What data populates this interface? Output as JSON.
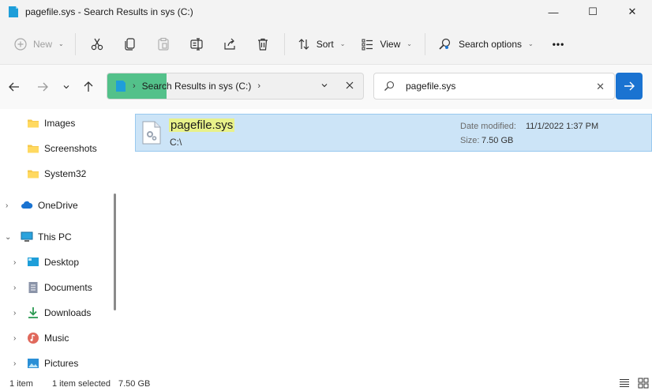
{
  "window": {
    "title": "pagefile.sys - Search Results in sys (C:)",
    "minimize_glyph": "—",
    "maximize_glyph": "☐",
    "close_glyph": "✕"
  },
  "toolbar": {
    "new_label": "New",
    "sort_label": "Sort",
    "view_label": "View",
    "search_options_label": "Search options",
    "more_label": "•••"
  },
  "address": {
    "location": "Search Results in sys (C:)",
    "progress_percent": 23
  },
  "search": {
    "value": "pagefile.sys"
  },
  "sidebar": {
    "items": [
      {
        "label": "Images",
        "icon": "folder-icon"
      },
      {
        "label": "Screenshots",
        "icon": "folder-icon"
      },
      {
        "label": "System32",
        "icon": "folder-icon"
      },
      {
        "label": "OneDrive",
        "icon": "cloud-icon"
      },
      {
        "label": "This PC",
        "icon": "computer-icon"
      },
      {
        "label": "Desktop",
        "icon": "desktop-icon"
      },
      {
        "label": "Documents",
        "icon": "documents-icon"
      },
      {
        "label": "Downloads",
        "icon": "downloads-icon"
      },
      {
        "label": "Music",
        "icon": "music-icon"
      },
      {
        "label": "Pictures",
        "icon": "pictures-icon"
      }
    ]
  },
  "result": {
    "name": "pagefile.sys",
    "path": "C:\\",
    "date_modified_label": "Date modified:",
    "date_modified_value": "11/1/2022 1:37 PM",
    "size_label": "Size:",
    "size_value": "7.50 GB"
  },
  "status": {
    "count": "1 item",
    "selected": "1 item selected",
    "size": "7.50 GB"
  },
  "colors": {
    "accent": "#1a73d1",
    "selection": "#cce4f7",
    "highlight": "#e8f18a",
    "progress": "#53c18a"
  }
}
